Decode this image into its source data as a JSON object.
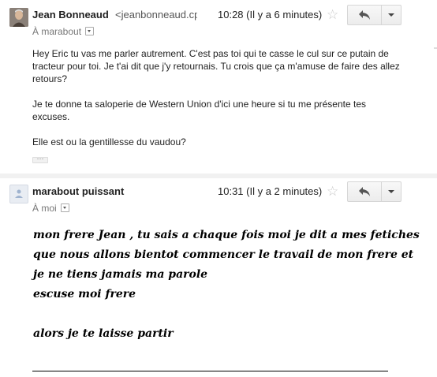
{
  "messages": [
    {
      "sender": "Jean Bonneaud",
      "email": "<jeanbonneaud.cp",
      "time": "10:28 (Il y a 6 minutes)",
      "recipient": "À marabout",
      "body": [
        "Hey Eric tu vas me parler autrement. C'est pas toi qui te casse le cul sur ce putain de tracteur pour toi. Je t'ai dit que j'y retournais. Tu crois que ça m'amuse de faire des allez retours?",
        "Je te donne ta saloperie de Western Union d'ici une heure si tu me présente tes excuses.",
        "Elle est ou la gentillesse du vaudou?"
      ],
      "ellipsis": "···"
    },
    {
      "sender": "marabout puissant",
      "time": "10:31 (Il y a 2 minutes)",
      "recipient": "À moi",
      "body_lines": [
        "mon frere Jean , tu sais a chaque fois moi je dit a mes fetiches",
        "que nous allons bientot commencer le travail de mon frere et",
        "je ne tiens jamais ma parole",
        "escuse moi frere",
        "",
        "alors je te laisse partir"
      ]
    }
  ],
  "icons": {
    "star": "star-outline-icon",
    "reply": "reply-arrow-icon",
    "more": "caret-down-icon"
  },
  "colors": {
    "star": "#c8c8c8",
    "button_border": "#d6d6d6",
    "muted_text": "#777777"
  }
}
